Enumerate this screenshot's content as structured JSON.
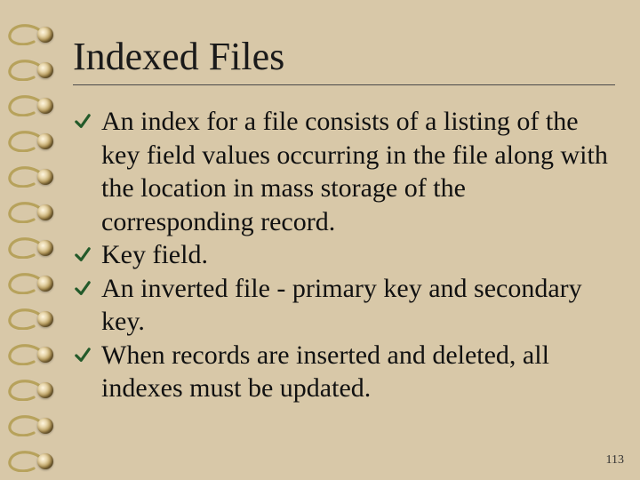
{
  "title": "Indexed Files",
  "bullets": {
    "b1": "An index for a file consists of a listing of the key field values occurring in the file along with the location in mass storage of the corresponding record.",
    "b2": "Key field.",
    "b3": "An inverted file - primary key and secondary key.",
    "b4": "When records are inserted and deleted, all indexes must be updated."
  },
  "page_number": "113",
  "colors": {
    "check": "#235a2a"
  }
}
